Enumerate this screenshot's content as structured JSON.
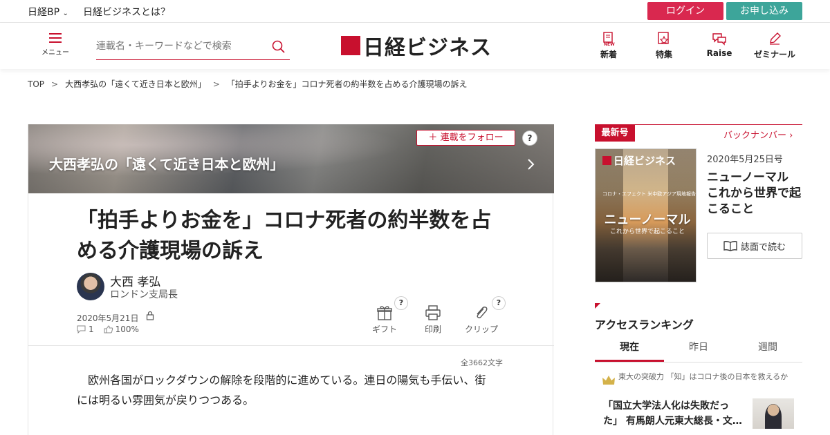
{
  "utility": {
    "nikkei_bp": "日経BP",
    "about": "日経ビジネスとは？",
    "login": "ログイン",
    "apply": "お申し込み"
  },
  "header": {
    "menu": "メニュー",
    "search_placeholder": "連載名・キーワードなどで検索",
    "logo": "日経ビジネス",
    "nav": [
      {
        "label": "新着",
        "icon": "new-icon"
      },
      {
        "label": "特集",
        "icon": "feature-icon"
      },
      {
        "label": "Raise",
        "icon": "raise-icon"
      },
      {
        "label": "ゼミナール",
        "icon": "seminar-icon"
      }
    ]
  },
  "breadcrumb": [
    "TOP",
    "大西孝弘の「遠くて近き日本と欧州」",
    "「拍手よりお金を」コロナ死者の約半数を占める介護現場の訴え"
  ],
  "article": {
    "series_title": "大西孝弘の「遠くて近き日本と欧州」",
    "follow": "連載をフォロー",
    "help": "?",
    "headline": "「拍手よりお金を」コロナ死者の約半数を占める介護現場の訴え",
    "author_name": "大西 孝弘",
    "author_role": "ロンドン支局長",
    "date": "2020年5月21日",
    "comments": "1",
    "likes": "100%",
    "actions": [
      "ギフト",
      "印刷",
      "クリップ"
    ],
    "char_count": "全3662文字",
    "body": "欧州各国がロックダウンの解除を段階的に進めている。連日の陽気も手伝い、街には明るい雰囲気が戻りつつある。"
  },
  "sidebar": {
    "latest_tag": "最新号",
    "back_numbers": "バックナンバー",
    "cover_logo": "日経ビジネス",
    "cover_kicker": "コロナ・エフェクト 米中欧アジア現地報告",
    "cover_title": "ニューノーマル",
    "cover_sub": "これから世界で起こること",
    "issue_date": "2020年5月25日号",
    "issue_title": "ニューノーマル これから世界で起こること",
    "read_button": "誌面で読む",
    "ranking_title": "アクセスランキング",
    "tabs": [
      "現在",
      "昨日",
      "週間"
    ],
    "rank_item": {
      "series": "東大の突破力 「知」はコロナ後の日本を救えるか",
      "headline": "「国立大学法人化は失敗だった」 有馬朗人元東大総長・文…"
    }
  },
  "colors": {
    "brand_red": "#c8102e",
    "login": "#d9284f",
    "apply": "#3da59a"
  }
}
